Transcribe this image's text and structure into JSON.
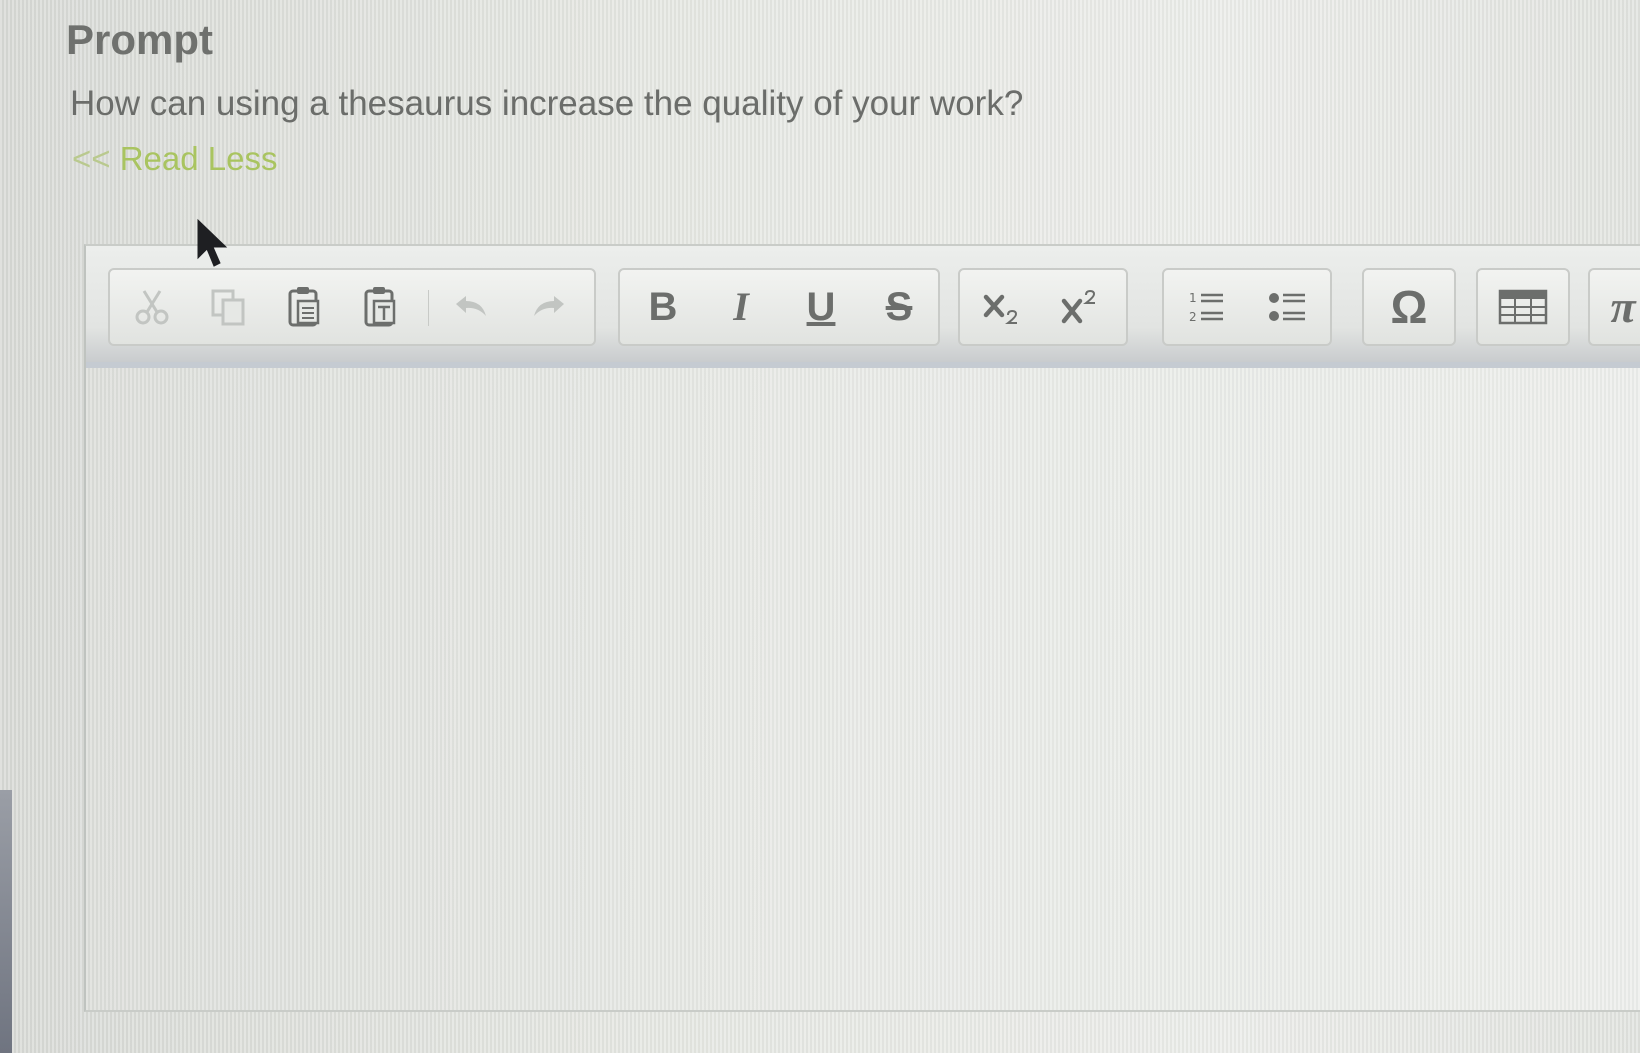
{
  "prompt": {
    "heading": "Prompt",
    "question": "How can using a thesaurus increase the quality of your work?",
    "read_less_arrows": "<<",
    "read_less_label": "Read Less"
  },
  "toolbar": {
    "bold_label": "B",
    "italic_label": "I",
    "underline_label": "U",
    "strike_label": "S",
    "special_char_label": "Ω",
    "pi_label": "π",
    "icons": [
      "cut-icon",
      "copy-icon",
      "paste-icon",
      "paste-text-icon",
      "undo-icon",
      "redo-icon",
      "bold-icon",
      "italic-icon",
      "underline-icon",
      "strikethrough-icon",
      "subscript-icon",
      "superscript-icon",
      "numbered-list-icon",
      "bulleted-list-icon",
      "special-character-icon",
      "table-icon",
      "math-pi-icon"
    ]
  },
  "editor": {
    "content": ""
  },
  "colors": {
    "heading": "#6f716e",
    "link": "#a9c460",
    "toolbar_border": "#c9cbc8"
  }
}
